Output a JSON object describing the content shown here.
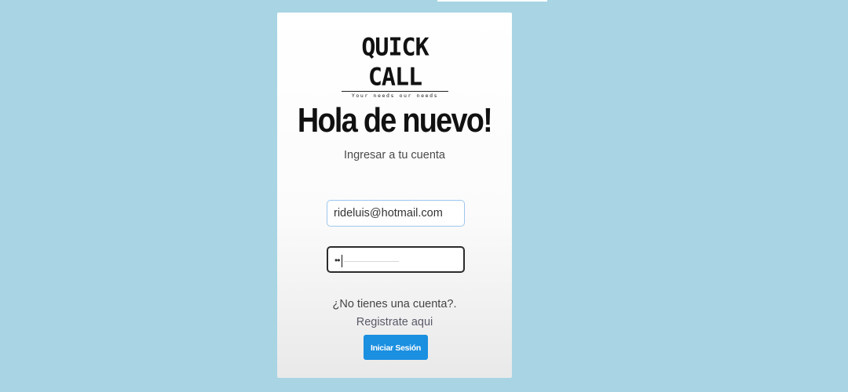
{
  "logo": {
    "name": "QUICK CALL",
    "tagline": "Your needs our needs"
  },
  "login": {
    "title": "Hola de nuevo!",
    "subtitle": "Ingresar a tu cuenta",
    "email_value": "rideluis@hotmail.com",
    "password_value": "••",
    "no_account_text": "¿No tienes una cuenta?.",
    "register_link": "Registrate aqui",
    "submit_label": "Iniciar Sesión"
  },
  "colors": {
    "background": "#a8d4e3",
    "button": "#1b8fe0",
    "email_border": "#9cc7ef",
    "password_border": "#2b2b2b"
  }
}
